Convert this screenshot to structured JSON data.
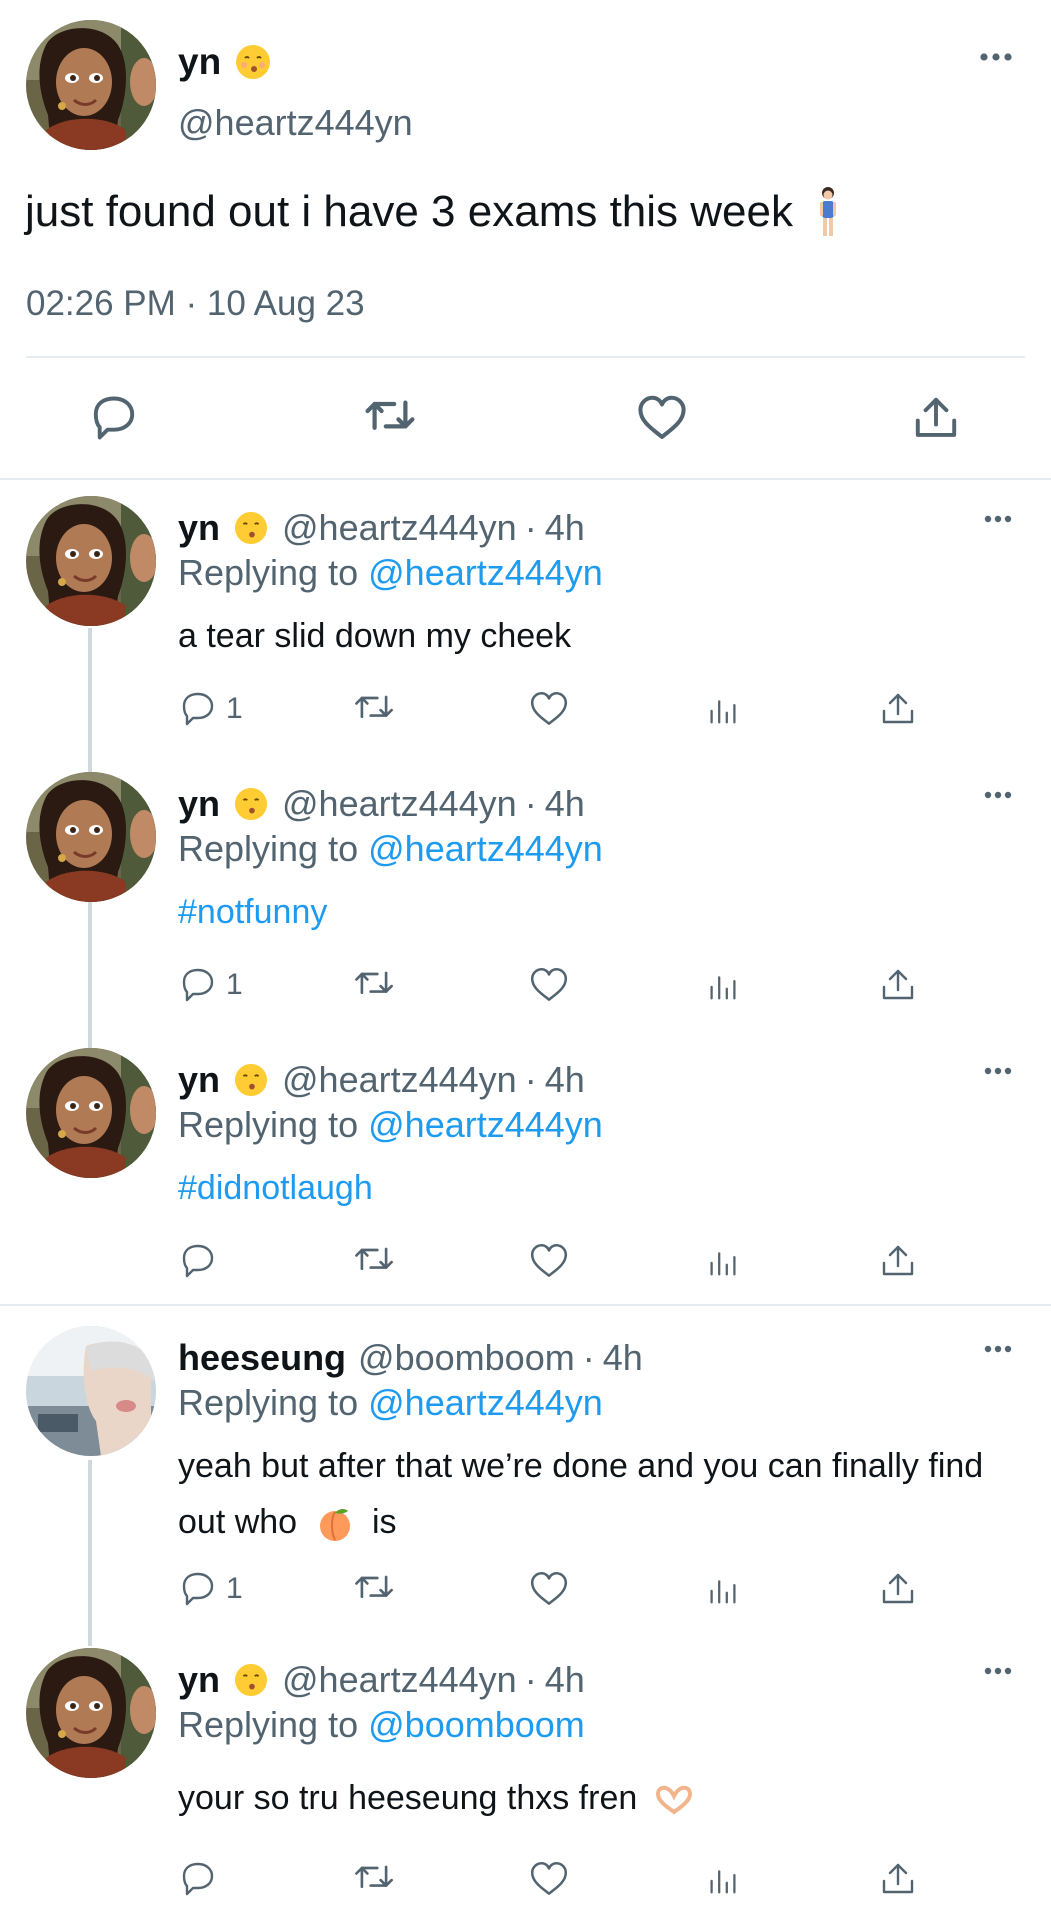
{
  "main_tweet": {
    "display_name": "yn",
    "name_emoji": "kissing-face",
    "handle": "@heartz444yn",
    "text": "just found out i have 3 exams this week",
    "text_emoji": "woman-standing",
    "timestamp": "02:26 PM · 10 Aug 23"
  },
  "replies": [
    {
      "display_name": "yn",
      "name_emoji": "kissing-face",
      "handle": "@heartz444yn",
      "time": "4h",
      "replying_label": "Replying to",
      "replying_to": "@heartz444yn",
      "text": "a tear slid down my cheek",
      "reply_count": "1"
    },
    {
      "display_name": "yn",
      "name_emoji": "kissing-face",
      "handle": "@heartz444yn",
      "time": "4h",
      "replying_label": "Replying to",
      "replying_to": "@heartz444yn",
      "text": "#notfunny",
      "reply_count": "1"
    },
    {
      "display_name": "yn",
      "name_emoji": "kissing-face",
      "handle": "@heartz444yn",
      "time": "4h",
      "replying_label": "Replying to",
      "replying_to": "@heartz444yn",
      "text": "#didnotlaugh",
      "reply_count": ""
    },
    {
      "display_name": "heeseung",
      "handle": "@boomboom",
      "time": "4h",
      "replying_label": "Replying to",
      "replying_to": "@heartz444yn",
      "text_before_emoji": "yeah but after that we’re done and you can finally find out who",
      "text_emoji": "peach",
      "text_after_emoji": "is",
      "reply_count": "1"
    },
    {
      "display_name": "yn",
      "name_emoji": "kissing-face",
      "handle": "@heartz444yn",
      "time": "4h",
      "replying_label": "Replying to",
      "replying_to": "@boomboom",
      "text": "your so tru heeseung thxs fren",
      "text_emoji": "heart-hands",
      "reply_count": ""
    }
  ],
  "colors": {
    "link": "#1d9bf0",
    "secondary_text": "#536471",
    "primary_text": "#0f1419",
    "divider": "#e6ecf0",
    "thread_line": "#cfd9de"
  }
}
